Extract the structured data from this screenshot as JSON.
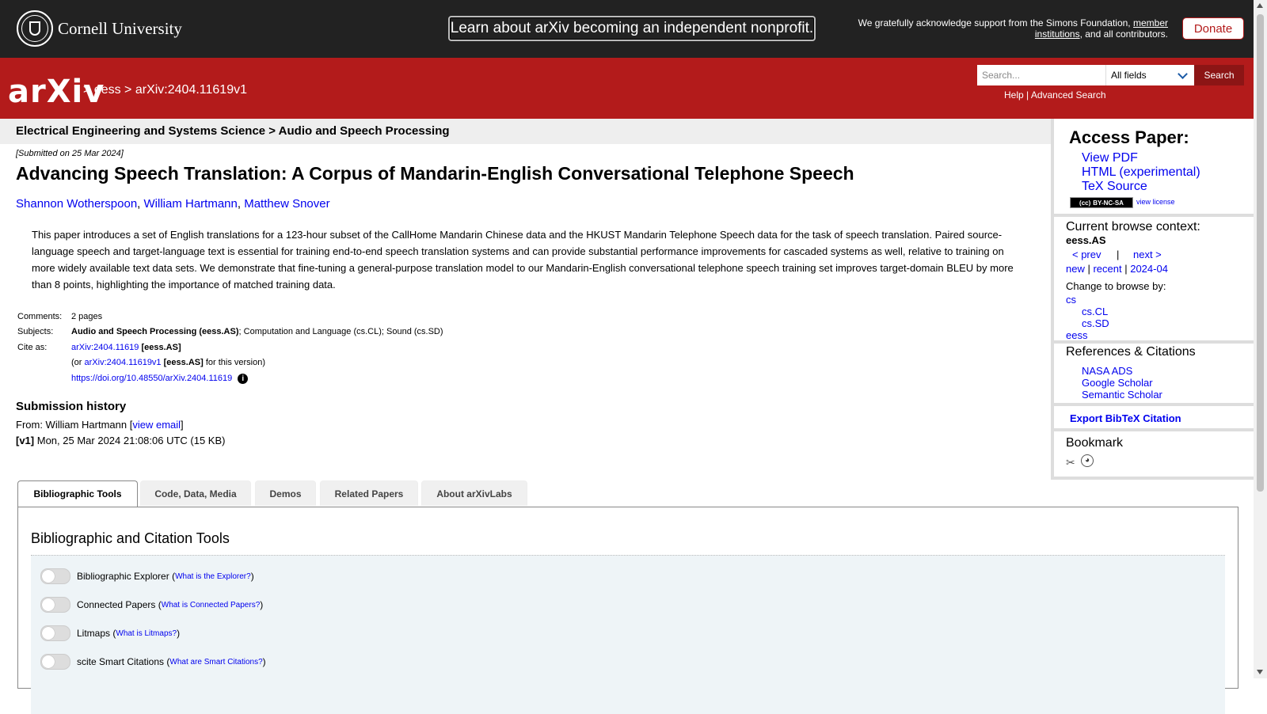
{
  "topbar": {
    "university": "Cornell University",
    "banner": "Learn about arXiv becoming an independent nonprofit.",
    "support_prefix": "We gratefully acknowledge support from the Simons Foundation,",
    "support_link": "member institutions",
    "support_suffix": ", and all contributors.",
    "donate": "Donate"
  },
  "header": {
    "logo": "arXiv",
    "crumb_sep1": ">",
    "crumb_cat": "eess",
    "crumb_sep2": ">",
    "crumb_id": "arXiv:2404.11619v1",
    "search_placeholder": "Search...",
    "search_field": "All fields",
    "search_button": "Search",
    "help": "Help",
    "help_sep": "|",
    "advanced": "Advanced Search"
  },
  "paper": {
    "subject_bar": "Electrical Engineering and Systems Science > Audio and Speech Processing",
    "submitted": "[Submitted on 25 Mar 2024]",
    "title": "Advancing Speech Translation: A Corpus of Mandarin-English Conversational Telephone Speech",
    "authors": [
      "Shannon Wotherspoon",
      "William Hartmann",
      "Matthew Snover"
    ],
    "abstract": "This paper introduces a set of English translations for a 123-hour subset of the CallHome Mandarin Chinese data and the HKUST Mandarin Telephone Speech data for the task of speech translation. Paired source-language speech and target-language text is essential for training end-to-end speech translation systems and can provide substantial performance improvements for cascaded systems as well, relative to training on more widely available text data sets. We demonstrate that fine-tuning a general-purpose translation model to our Mandarin-English conversational telephone speech training set improves target-domain BLEU by more than 8 points, highlighting the importance of matched training data.",
    "comments_label": "Comments:",
    "comments": "2 pages",
    "subjects_label": "Subjects:",
    "subjects_primary": "Audio and Speech Processing (eess.AS)",
    "subjects_rest": "; Computation and Language (cs.CL); Sound (cs.SD)",
    "cite_label": "Cite as:",
    "cite_id": "arXiv:2404.11619",
    "cite_tag": "[eess.AS]",
    "cite_or": "(or",
    "cite_version_id": "arXiv:2404.11619v1",
    "cite_version_tag": "[eess.AS]",
    "cite_version_suffix": "for this version)",
    "doi": "https://doi.org/10.48550/arXiv.2404.11619",
    "history_title": "Submission history",
    "from_prefix": "From: William Hartmann [",
    "view_email": "view email",
    "from_suffix": "]",
    "v1_label": "[v1]",
    "v1_text": "Mon, 25 Mar 2024 21:08:06 UTC (15 KB)"
  },
  "sidebar": {
    "access_title": "Access Paper:",
    "view_pdf": "View PDF",
    "html": "HTML (experimental)",
    "tex": "TeX Source",
    "license_badge": "BY-NC-SA",
    "view_license": "view license",
    "browse_title": "Current browse context:",
    "browse_context": "eess.AS",
    "prev": "< prev",
    "nav_sep": "|",
    "next": "next >",
    "new": "new",
    "recent": "recent",
    "month": "2024-04",
    "change_browse": "Change to browse by:",
    "browse_cs": "cs",
    "browse_cscl": "cs.CL",
    "browse_cssd": "cs.SD",
    "browse_eess": "eess",
    "refs_title": "References & Citations",
    "nasa": "NASA ADS",
    "google": "Google Scholar",
    "semantic": "Semantic Scholar",
    "bibtex": "Export BibTeX Citation",
    "bookmark": "Bookmark"
  },
  "tabs": [
    "Bibliographic Tools",
    "Code, Data, Media",
    "Demos",
    "Related Papers",
    "About arXivLabs"
  ],
  "panel": {
    "title": "Bibliographic and Citation Tools",
    "tools": [
      {
        "label": "Bibliographic Explorer",
        "help": "What is the Explorer?"
      },
      {
        "label": "Connected Papers",
        "help": "What is Connected Papers?"
      },
      {
        "label": "Litmaps",
        "help": "What is Litmaps?"
      },
      {
        "label": "scite Smart Citations",
        "help": "What are Smart Citations?"
      }
    ]
  },
  "colors": {
    "arxiv_red": "#b31b1b",
    "top_dark": "#222222",
    "link": "#0000ee"
  }
}
